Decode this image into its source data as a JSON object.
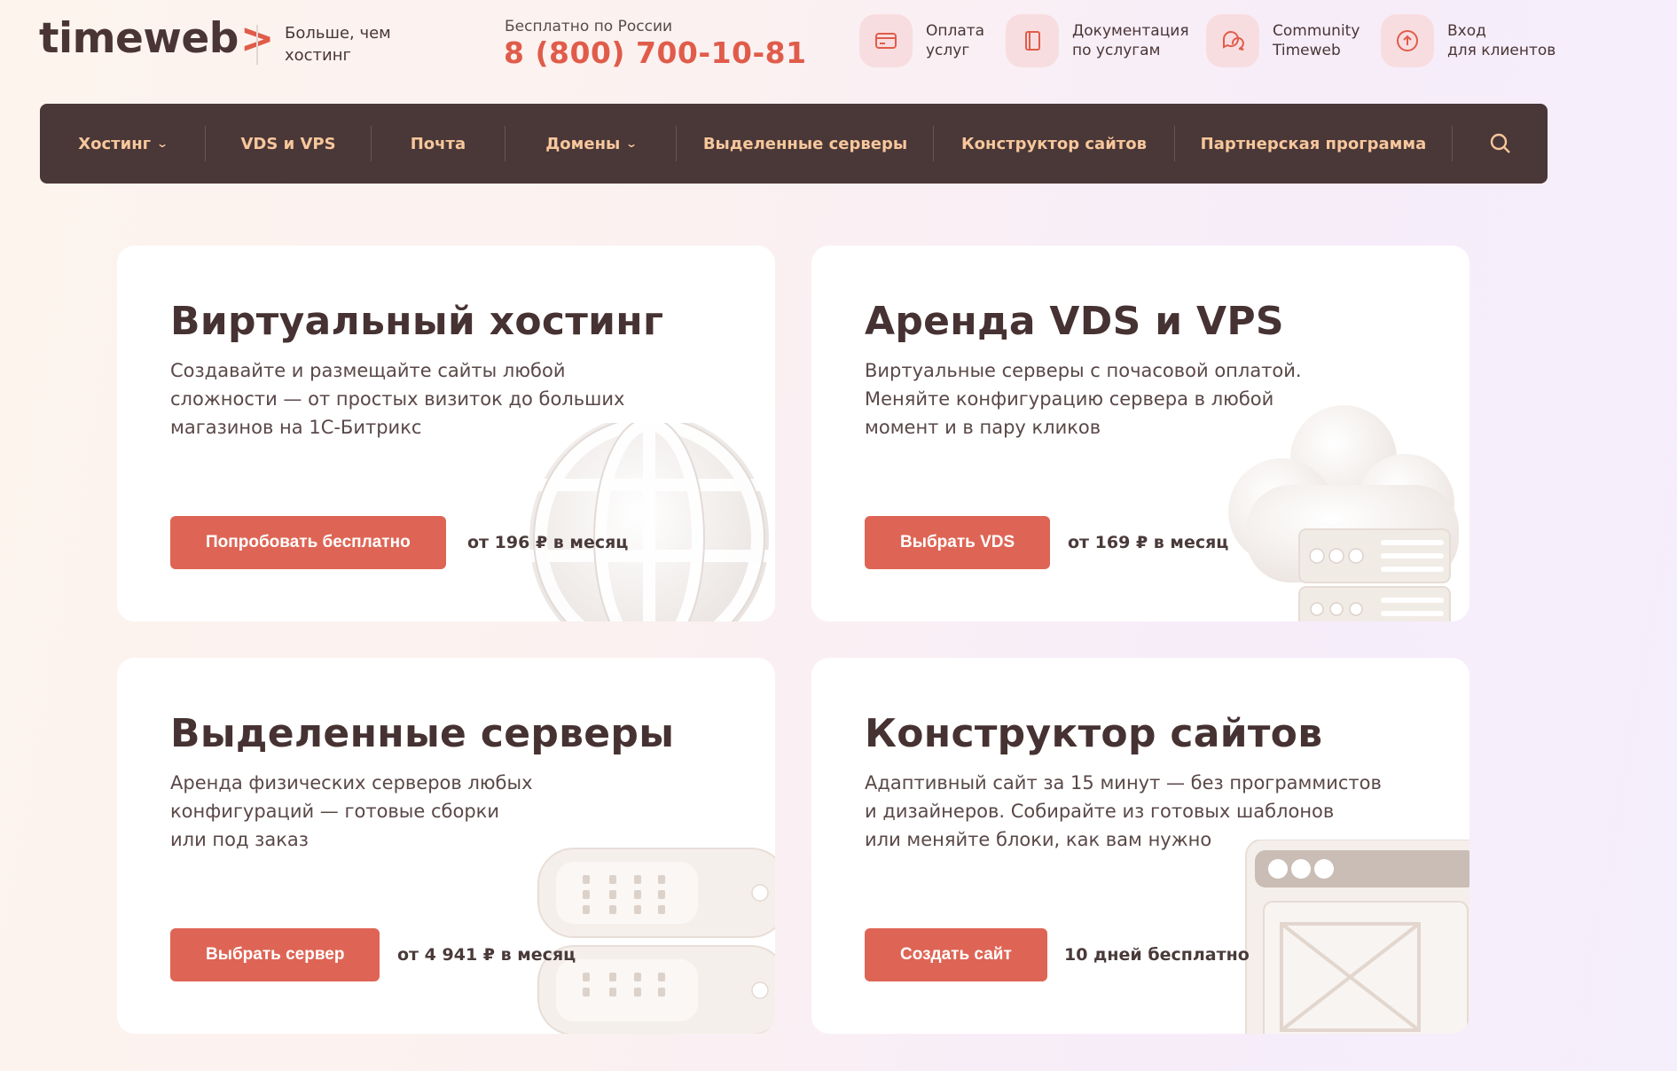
{
  "header": {
    "logo_text": "timeweb",
    "logo_arrow": ">",
    "tagline": "Больше, чем хостинг",
    "phone_caption": "Бесплатно по России",
    "phone_number": "8 (800) 700-10-81",
    "quick_links": [
      {
        "line1": "Оплата",
        "line2": "услуг",
        "icon": "card-icon"
      },
      {
        "line1": "Документация",
        "line2": "по услугам",
        "icon": "book-icon"
      },
      {
        "line1": "Community",
        "line2": "Timeweb",
        "icon": "chat-icon"
      },
      {
        "line1": "Вход",
        "line2": "для клиентов",
        "icon": "login-icon"
      }
    ]
  },
  "nav": {
    "items": [
      {
        "label": "Хостинг",
        "dropdown": true
      },
      {
        "label": "VDS и VPS",
        "dropdown": false
      },
      {
        "label": "Почта",
        "dropdown": false
      },
      {
        "label": "Домены",
        "dropdown": true
      },
      {
        "label": "Выделенные серверы",
        "dropdown": false
      },
      {
        "label": "Конструктор сайтов",
        "dropdown": false
      },
      {
        "label": "Партнерская программа",
        "dropdown": false
      }
    ],
    "search_icon": "search-icon",
    "chevron": "⌄"
  },
  "cards": [
    {
      "title": "Виртуальный хостинг",
      "desc": [
        "Создавайте и размещайте сайты любой",
        "сложности — от простых визиток до больших",
        "магазинов на 1С-Битрикс"
      ],
      "button": "Попробовать бесплатно",
      "price": "от 196 ₽ в месяц",
      "illustration": "globe-icon"
    },
    {
      "title": "Аренда VDS и VPS",
      "desc": [
        "Виртуальные серверы с почасовой оплатой.",
        "Меняйте конфигурацию сервера в любой",
        "момент и в пару кликов"
      ],
      "button": "Выбрать VDS",
      "price": "от 169 ₽ в месяц",
      "illustration": "cloud-server-icon"
    },
    {
      "title": "Выделенные серверы",
      "desc": [
        "Аренда физических серверов любых",
        "конфигураций — готовые сборки",
        "или под заказ"
      ],
      "button": "Выбрать сервер",
      "price": "от 4 941 ₽ в месяц",
      "illustration": "server-rack-icon"
    },
    {
      "title": "Конструктор сайтов",
      "desc": [
        "Адаптивный сайт за 15 минут — без программистов",
        "и дизайнеров. Собирайте из готовых шаблонов",
        "или меняйте блоки, как вам нужно"
      ],
      "button": "Создать сайт",
      "price": "10 дней бесплатно",
      "illustration": "browser-window-icon"
    }
  ],
  "colors": {
    "accent": "#de6555",
    "brand_red": "#e05c4a",
    "nav_bg": "#4a3737",
    "nav_text": "#f7c79c",
    "text_dark": "#463232"
  }
}
